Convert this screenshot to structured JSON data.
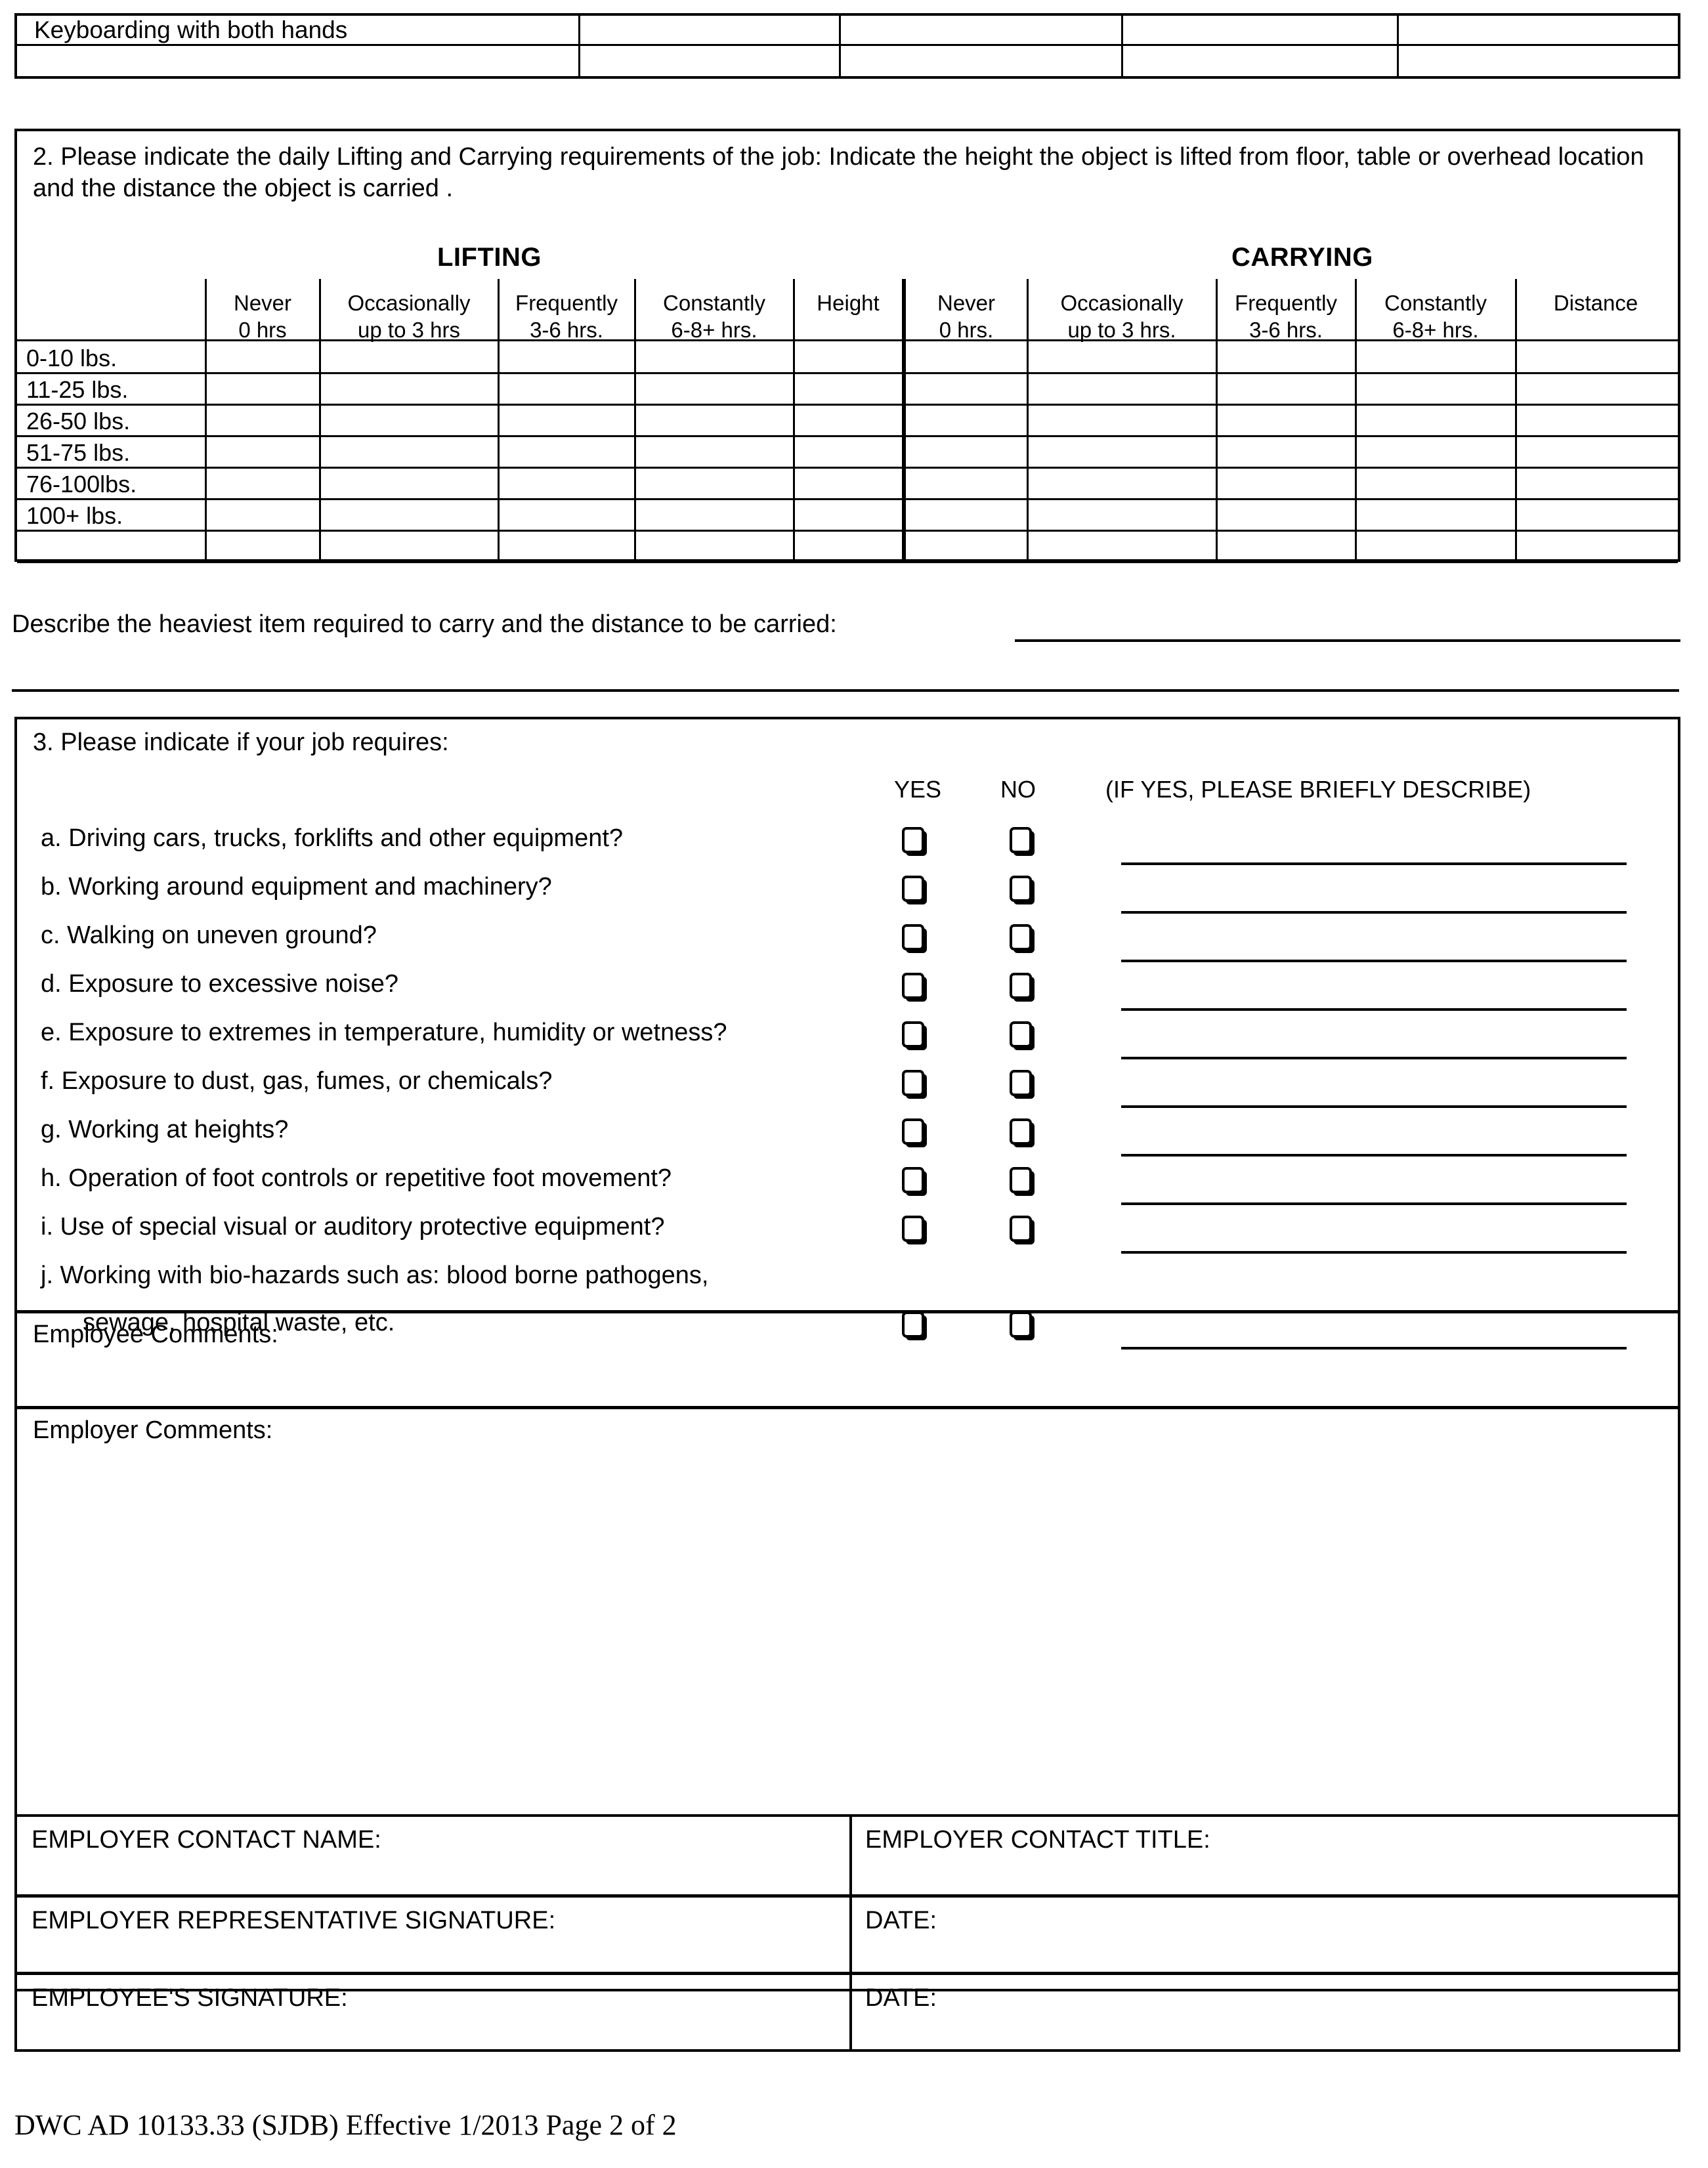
{
  "top_table": {
    "rows": [
      {
        "label": "Keyboarding with both hands"
      },
      {
        "label": ""
      }
    ],
    "columns": 5
  },
  "section2": {
    "number_and_intro": "2.  Please indicate the daily Lifting and Carrying requirements of the job: Indicate the height the object is lifted from floor, table or overhead location and the distance the object is carried .",
    "group_headers": {
      "lifting": "LIFTING",
      "carrying": "CARRYING"
    },
    "lifting_columns": [
      {
        "name": "Never",
        "sub": "0 hrs"
      },
      {
        "name": "Occasionally",
        "sub": "up to 3 hrs"
      },
      {
        "name": "Frequently",
        "sub": "3-6 hrs."
      },
      {
        "name": "Constantly",
        "sub": "6-8+ hrs."
      },
      {
        "name": "Height",
        "sub": ""
      }
    ],
    "carrying_columns": [
      {
        "name": "Never",
        "sub": "0 hrs."
      },
      {
        "name": "Occasionally",
        "sub": "up to 3 hrs."
      },
      {
        "name": "Frequently",
        "sub": "3-6 hrs."
      },
      {
        "name": "Constantly",
        "sub": "6-8+ hrs."
      },
      {
        "name": "Distance",
        "sub": ""
      }
    ],
    "weight_rows": [
      "0-10 lbs.",
      "11-25 lbs.",
      "26-50 lbs.",
      "51-75 lbs.",
      "76-100lbs.",
      "100+ lbs."
    ],
    "describe_heaviest": "Describe the heaviest item required to carry and the distance to be carried:"
  },
  "section3": {
    "title": "3.  Please indicate if your job requires:",
    "yes_header": "YES",
    "no_header": "NO",
    "describe_header": "(IF YES, PLEASE BRIEFLY DESCRIBE)",
    "questions": [
      {
        "letter": "a.",
        "text": "a.  Driving cars, trucks, forklifts and other equipment?"
      },
      {
        "letter": "b.",
        "text": "b.  Working around equipment and machinery?"
      },
      {
        "letter": "c.",
        "text": "c.  Walking on uneven ground?"
      },
      {
        "letter": "d.",
        "text": "d.  Exposure to excessive noise?"
      },
      {
        "letter": "e.",
        "text": "e.  Exposure to extremes in temperature, humidity or wetness?"
      },
      {
        "letter": "f.",
        "text": "f.  Exposure to dust, gas, fumes, or chemicals?"
      },
      {
        "letter": "g.",
        "text": "g.  Working at heights?"
      },
      {
        "letter": "h.",
        "text": "h.  Operation of foot controls or repetitive foot movement?"
      },
      {
        "letter": "i.",
        "text": "i.  Use of special visual or auditory protective equipment?"
      },
      {
        "letter": "j.",
        "text": "j.  Working with bio-hazards such as:  blood borne pathogens,"
      },
      {
        "letter": "j2",
        "text": "sewage, hospital waste, etc."
      }
    ],
    "employee_comments_label": "Employee Comments:",
    "employer_comments_label": "Employer Comments:"
  },
  "signature_table": {
    "rows": [
      {
        "left": "EMPLOYER CONTACT NAME:",
        "right": "EMPLOYER CONTACT TITLE:"
      },
      {
        "left": "EMPLOYER REPRESENTATIVE SIGNATURE:",
        "right": "DATE:"
      },
      {
        "left": "EMPLOYEE'S SIGNATURE:",
        "right": "DATE:"
      }
    ]
  },
  "footer": {
    "text": "DWC AD 10133.33 (SJDB) Effective  1/2013 Page 2 of 2"
  }
}
